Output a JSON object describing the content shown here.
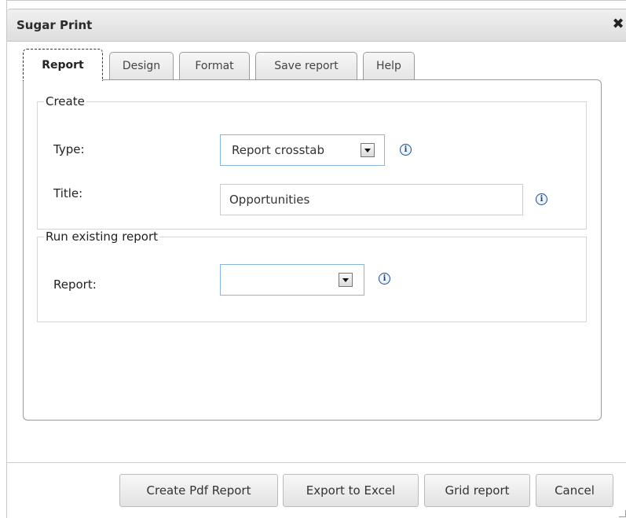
{
  "dialog": {
    "title": "Sugar Print",
    "close_icon": "close-icon"
  },
  "tabs": [
    {
      "label": "Report",
      "active": true
    },
    {
      "label": "Design",
      "active": false
    },
    {
      "label": "Format",
      "active": false
    },
    {
      "label": "Save report",
      "active": false
    },
    {
      "label": "Help",
      "active": false
    }
  ],
  "create": {
    "legend": "Create",
    "type_label": "Type:",
    "type_value": "Report crosstab",
    "title_label": "Title:",
    "title_value": "Opportunities"
  },
  "run_existing": {
    "legend": "Run existing report",
    "report_label": "Report:",
    "report_value": ""
  },
  "buttons": {
    "create_pdf": "Create Pdf Report",
    "export_excel": "Export to Excel",
    "grid_report": "Grid report",
    "cancel": "Cancel"
  },
  "icons": {
    "info": "info-icon",
    "dropdown": "chevron-down-icon"
  },
  "colors": {
    "select_border": "#8ab4e0",
    "info_icon": "#1c4f8f"
  }
}
